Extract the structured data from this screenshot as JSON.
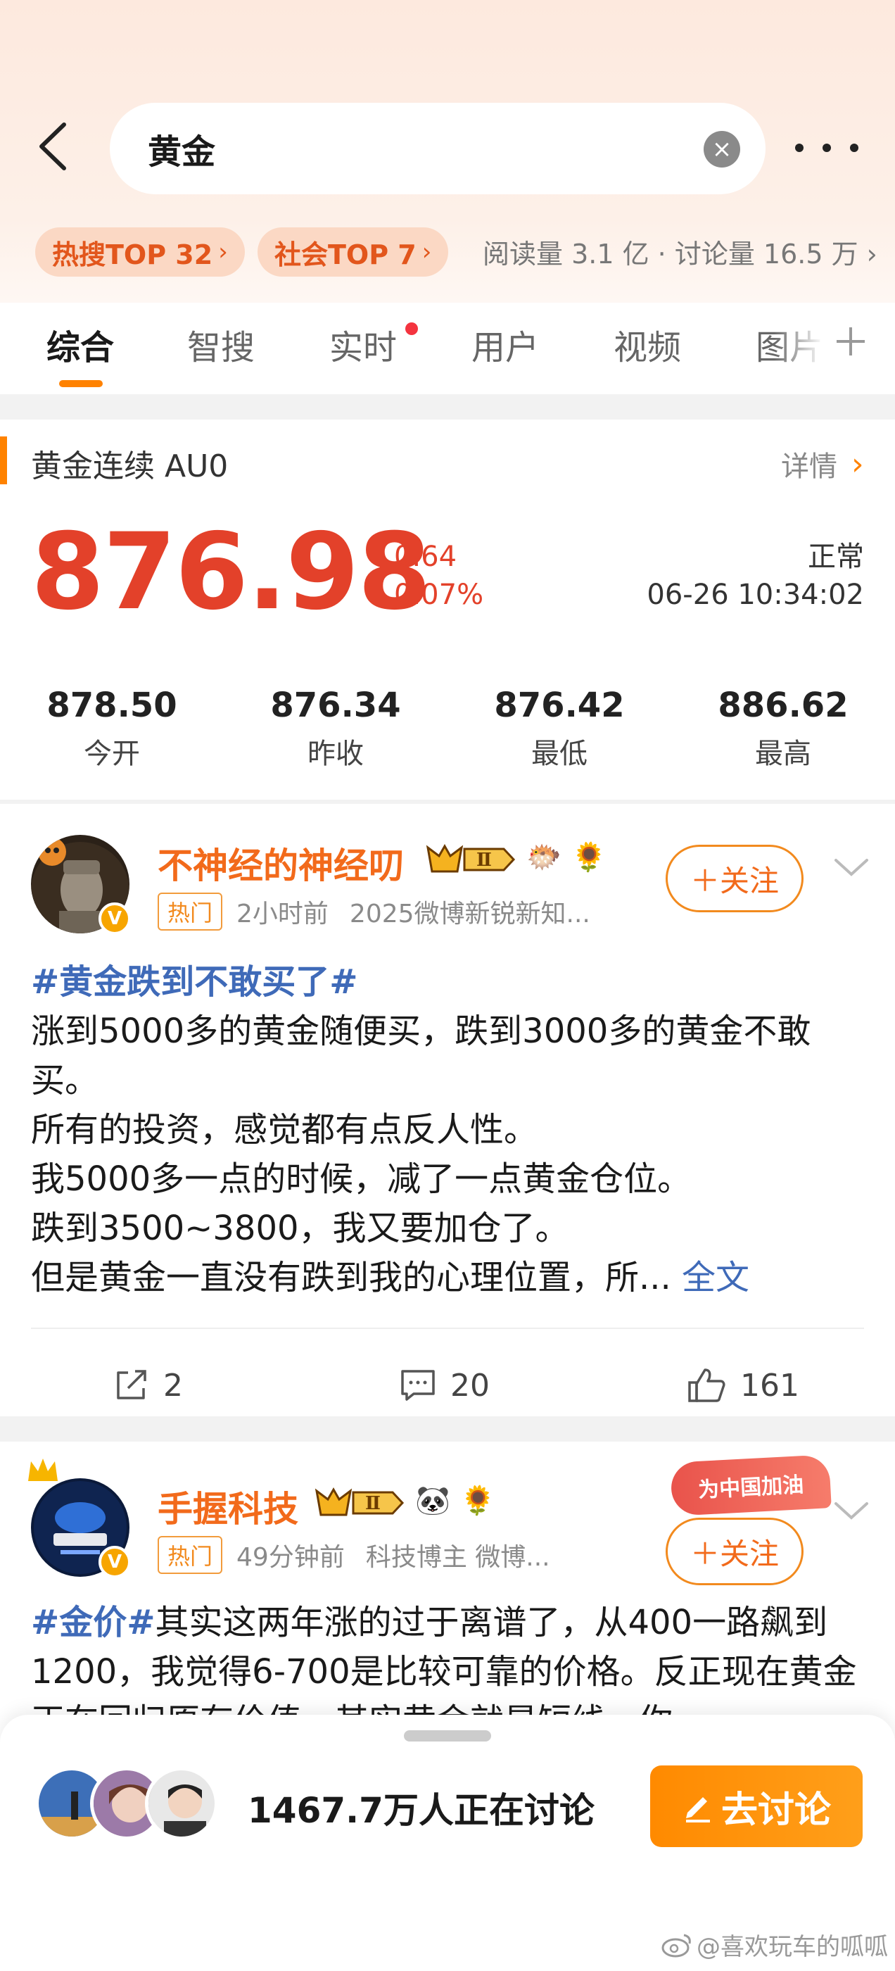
{
  "search": {
    "query": "黄金"
  },
  "hot_pills": [
    {
      "label": "热搜TOP 32",
      "chevron": "›"
    },
    {
      "label": "社会TOP 7",
      "chevron": "›"
    }
  ],
  "stats_line": "阅读量 3.1 亿 · 讨论量 16.5 万 ›",
  "tabs": [
    "综合",
    "智搜",
    "实时",
    "用户",
    "视频",
    "图片"
  ],
  "active_tab": "综合",
  "gold": {
    "title": "黄金连续 AU0",
    "detail": "详情",
    "price": "876.98",
    "change_abs": "0.64",
    "change_pct": "0.07%",
    "status": "正常",
    "time": "06-26 10:34:02",
    "stats": [
      {
        "value": "878.50",
        "label": "今开"
      },
      {
        "value": "876.34",
        "label": "昨收"
      },
      {
        "value": "876.42",
        "label": "最低"
      },
      {
        "value": "886.62",
        "label": "最高"
      }
    ],
    "accent_color": "#e3412a"
  },
  "posts": [
    {
      "username": "不神经的神经叨",
      "level": "Ⅱ",
      "hot_tag": "热门",
      "time": "2小时前",
      "source": "2025微博新锐新知...",
      "follow": "＋关注",
      "topic": "#黄金跌到不敢买了#",
      "lines": [
        "涨到5000多的黄金随便买，跌到3000多的黄金不敢买。",
        "所有的投资，感觉都有点反人性。",
        "我5000多一点的时候，减了一点黄金仓位。",
        "跌到3500~3800，我又要加仓了。",
        "但是黄金一直没有跌到我的心理位置，所..."
      ],
      "full_text": "全文",
      "reposts": "2",
      "comments": "20",
      "likes": "161"
    },
    {
      "username": "手握科技",
      "level": "Ⅱ",
      "hot_tag": "热门",
      "time": "49分钟前",
      "source": "科技博主 微博...",
      "follow": "＋关注",
      "promo": "为中国加油",
      "topic": "#金价#",
      "body": "其实这两年涨的过于离谱了，从400一路飙到1200，我觉得6-700是比较可靠的价格。反正现在黄金正在回归原有价值，其实黄金就是短线，你"
    }
  ],
  "bottom": {
    "discussing": "1467.7万人正在讨论",
    "discuss_button": "去讨论"
  },
  "watermark": "@喜欢玩车的呱呱"
}
